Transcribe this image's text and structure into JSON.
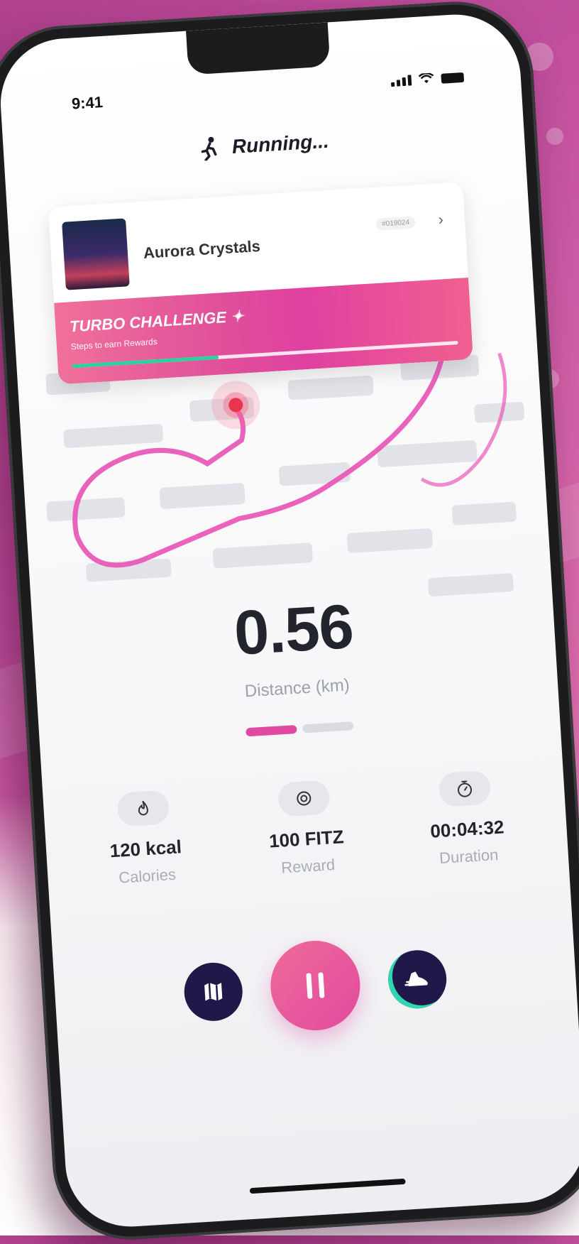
{
  "status_bar": {
    "time": "9:41"
  },
  "header": {
    "title": "Running..."
  },
  "challenge_card": {
    "track_name": "Aurora Crystals",
    "tag": "#019024",
    "banner_title": "TURBO CHALLENGE",
    "banner_subtitle": "Steps to earn Rewards",
    "progress": 0.38
  },
  "main_metric": {
    "value": "0.56",
    "label": "Distance (km)"
  },
  "pager": {
    "pages": 2,
    "active": 0
  },
  "stats": [
    {
      "icon": "flame-icon",
      "value": "120 kcal",
      "label": "Calories"
    },
    {
      "icon": "target-icon",
      "value": "100 FITZ",
      "label": "Reward"
    },
    {
      "icon": "stopwatch-icon",
      "value": "00:04:32",
      "label": "Duration"
    }
  ],
  "controls": {
    "left_icon": "map-icon",
    "center_icon": "pause-icon",
    "right_icon": "sneaker-icon"
  },
  "colors": {
    "accent": "#e04aa0",
    "accent_light": "#f06a98",
    "dark_button": "#211849",
    "progress_green": "#29d3a0"
  }
}
